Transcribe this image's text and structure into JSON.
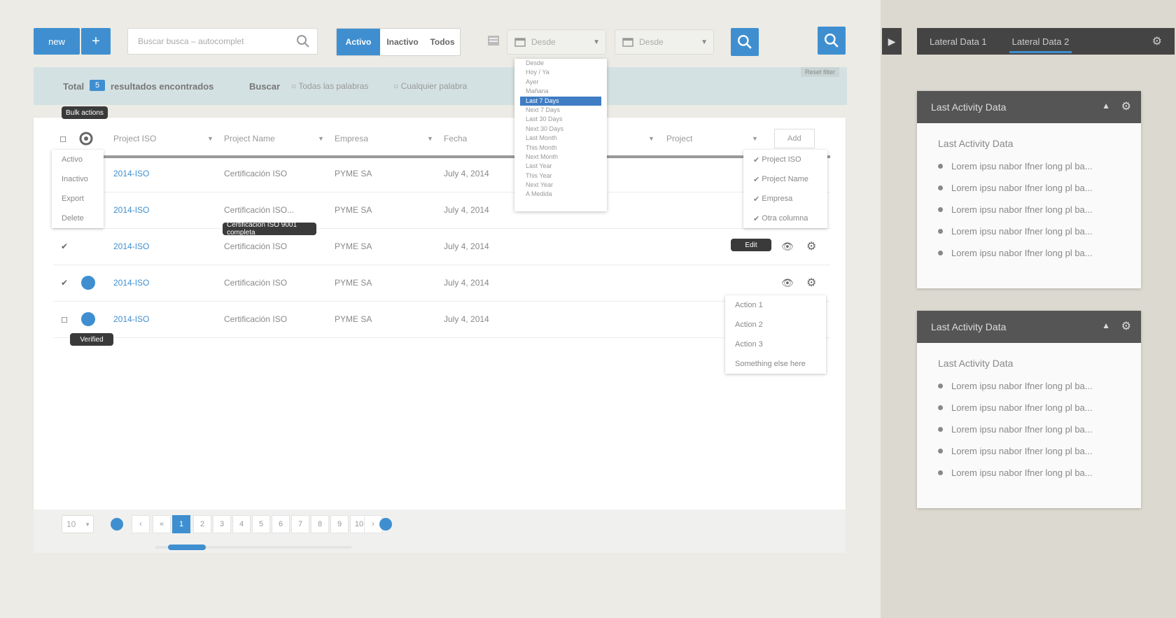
{
  "toolbar": {
    "new_label": "new",
    "plus_label": "+",
    "search_placeholder": "Buscar busca – autocomplet",
    "seg": [
      "Activo",
      "Inactivo",
      "Todos"
    ],
    "date_from": "Desde",
    "date_to": "Desde"
  },
  "info": {
    "total_prefix": "Total",
    "count": "5",
    "found_text": "resultados encontrados",
    "search_label": "Buscar",
    "opt1": "Todas las palabras",
    "opt2": "Cualquier palabra",
    "clear": "Reset filter"
  },
  "date_dropdown": {
    "items": [
      "Desde",
      "Hoy / Ya",
      "Ayer",
      "Mañana",
      "Last 7 Days",
      "Next 7 Days",
      "Last 30 Days",
      "Next 30 Days",
      "Last Month",
      "This Month",
      "Next Month",
      "Last Year",
      "This Year",
      "Next Year",
      "A Medida"
    ],
    "selected_index": 4
  },
  "table": {
    "headers": [
      "Project ISO",
      "Project Name",
      "Empresa",
      "Fecha",
      "Project",
      "Add"
    ],
    "rows": [
      {
        "iso": "2014-ISO",
        "name": "Certificación ISO",
        "empresa": "PYME SA",
        "fecha": "July 4, 2014"
      },
      {
        "iso": "2014-ISO",
        "name": "Certificación ISO...",
        "empresa": "PYME SA",
        "fecha": "July 4, 2014"
      },
      {
        "iso": "2014-ISO",
        "name": "Certificación ISO",
        "empresa": "PYME SA",
        "fecha": "July 4, 2014"
      },
      {
        "iso": "2014-ISO",
        "name": "Certificación ISO",
        "empresa": "PYME SA",
        "fecha": "July 4, 2014"
      },
      {
        "iso": "2014-ISO",
        "name": "Certificación ISO",
        "empresa": "PYME SA",
        "fecha": "July 4, 2014"
      }
    ],
    "bulk_menu": [
      "Activo",
      "Inactivo",
      "Export",
      "Delete"
    ],
    "column_menu": [
      "Project ISO",
      "Project Name",
      "Empresa",
      "Otra columna"
    ],
    "action_menu": [
      "Action 1",
      "Action 2",
      "Action 3",
      "Something else here"
    ],
    "tooltips": {
      "bulk": "Bulk actions",
      "name": "Certificación ISO 9001 completa",
      "row": "Edit",
      "status": "Verified"
    }
  },
  "pagination": {
    "per_page": "10",
    "pages": [
      "1",
      "2",
      "3",
      "4",
      "5",
      "6",
      "7",
      "8",
      "9",
      "10"
    ],
    "active": "1"
  },
  "sidebar": {
    "tabs": [
      "Lateral Data 1",
      "Lateral Data 2"
    ],
    "cards": [
      {
        "title": "Last Activity Data",
        "subtitle": "Last Activity Data",
        "items": [
          "Lorem ipsu nabor Ifner long pl ba...",
          "Lorem ipsu nabor Ifner long pl ba...",
          "Lorem ipsu nabor Ifner long pl ba...",
          "Lorem ipsu nabor Ifner long pl ba...",
          "Lorem ipsu nabor Ifner long pl ba..."
        ]
      },
      {
        "title": "Last Activity Data",
        "subtitle": "Last Activity Data",
        "items": [
          "Lorem ipsu nabor Ifner long pl ba...",
          "Lorem ipsu nabor Ifner long pl ba...",
          "Lorem ipsu nabor Ifner long pl ba...",
          "Lorem ipsu nabor Ifner long pl ba...",
          "Lorem ipsu nabor Ifner long pl ba..."
        ]
      }
    ]
  },
  "colors": {
    "accent": "#3f8fd0",
    "dark": "#444444",
    "info_bg": "#d4e1e2"
  }
}
